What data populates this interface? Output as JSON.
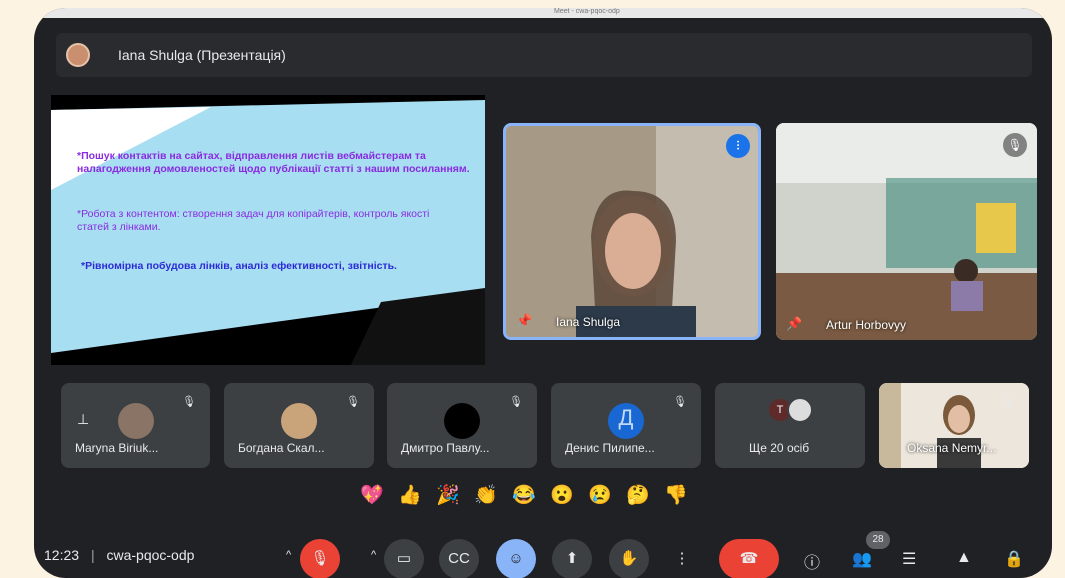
{
  "window": {
    "tab_title": "Meet - cwa-pqoc-odp"
  },
  "presenter": {
    "title": "Iana Shulga (Презентація)"
  },
  "slide": {
    "line1": "*Пошук контактів на сайтах, відправлення листів вебмайстерам та налагодження домовленостей щодо публікації статті з нашим посиланням.",
    "line2": "*Робота з контентом: створення задач для копірайтерів, контроль якості статей з лінками.",
    "line3": "*Рівномірна побудова лінків, аналіз ефективності, звітність."
  },
  "main_tiles": [
    {
      "name": "Iana Shulga"
    },
    {
      "name": "Artur Horbovyy"
    }
  ],
  "small_tiles": [
    {
      "name": "Maryna Biriuk..."
    },
    {
      "name": "Богдана Скал..."
    },
    {
      "name": "Дмитро Павлу..."
    },
    {
      "name": "Денис Пилипе...",
      "letter": "Д"
    },
    {
      "name": "Ще 20 осіб",
      "letter": "T"
    },
    {
      "name": "Oksana Nemyr..."
    }
  ],
  "reactions": [
    "💖",
    "👍",
    "🎉",
    "👏",
    "😂",
    "😮",
    "😢",
    "🤔",
    "👎"
  ],
  "bottom": {
    "time": "12:23",
    "separator": "|",
    "meeting_code": "cwa-pqoc-odp",
    "participant_count": "28"
  },
  "colors": {
    "accent": "#8ab4f8",
    "danger": "#ea4335",
    "surface": "#3c4043",
    "bg": "#202124"
  }
}
